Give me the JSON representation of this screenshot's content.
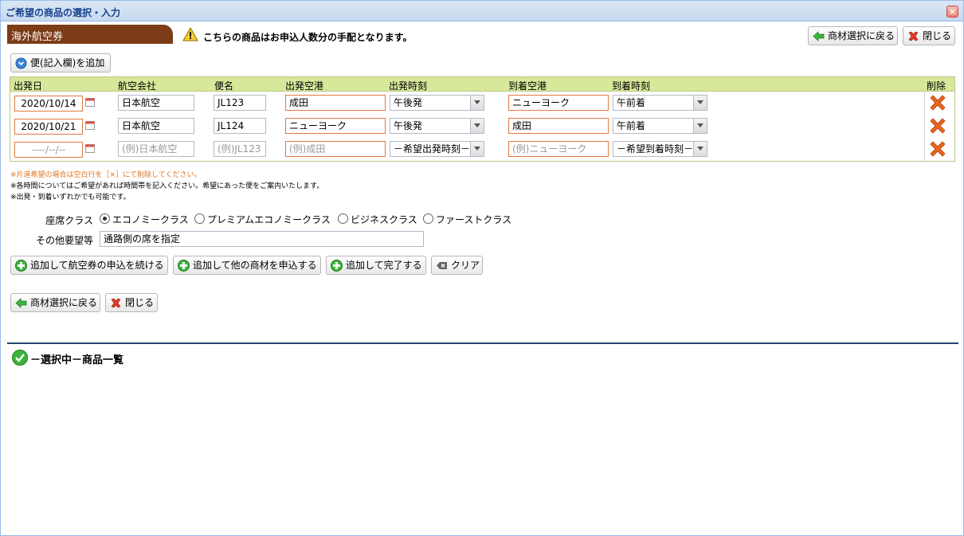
{
  "window": {
    "title": "ご希望の商品の選択・入力",
    "close_glyph": "×"
  },
  "section_tab": "海外航空券",
  "notice": "こちらの商品はお申込人数分の手配となります。",
  "top_buttons": {
    "back": "商材選択に戻る",
    "close": "閉じる"
  },
  "add_flight_button": "便(記入欄)を追加",
  "grid": {
    "headers": [
      "出発日",
      "航空会社",
      "便名",
      "出発空港",
      "出発時刻",
      "到着空港",
      "到着時刻",
      "削除"
    ],
    "rows": [
      {
        "date": "2020/10/14",
        "airline": "日本航空",
        "flight": "JL123",
        "dep_airport": "成田",
        "dep_time": "午後発",
        "arr_airport": "ニューヨーク",
        "arr_time": "午前着"
      },
      {
        "date": "2020/10/21",
        "airline": "日本航空",
        "flight": "JL124",
        "dep_airport": "ニューヨーク",
        "dep_time": "午後発",
        "arr_airport": "成田",
        "arr_time": "午前着"
      }
    ],
    "blank_row": {
      "date": "----/--/--",
      "airline": "(例)日本航空",
      "flight": "(例)JL123",
      "dep_airport": "(例)成田",
      "dep_time": "－希望出発時刻－",
      "arr_airport": "(例)ニューヨーク",
      "arr_time": "－希望到着時刻－"
    }
  },
  "notes": [
    "※片道希望の場合は空白行を［×］にて削除してください。",
    "※各時間についてはご希望があれば時間帯を記入ください。希望にあった便をご案内いたします。",
    "※出発・到着いずれかでも可能です。"
  ],
  "seat_class": {
    "label": "座席クラス",
    "options": [
      "エコノミークラス",
      "プレミアムエコノミークラス",
      "ビジネスクラス",
      "ファーストクラス"
    ],
    "selected": "エコノミークラス"
  },
  "other_requests": {
    "label": "その他要望等",
    "value": "通路側の席を指定"
  },
  "action_buttons": {
    "continue_flight": "追加して航空券の申込を続ける",
    "other_product": "追加して他の商材を申込する",
    "complete": "追加して完了する",
    "clear": "クリア"
  },
  "bottom_buttons": {
    "back": "商材選択に戻る",
    "close": "閉じる"
  },
  "selected_list_title": "－選択中－商品一覧",
  "colors": {
    "tab_brown": "#7b3c16",
    "header_green": "#d8e89a",
    "required_orange": "#e07a3c",
    "delete_orange": "#e8661e",
    "separator_navy": "#23466e"
  }
}
